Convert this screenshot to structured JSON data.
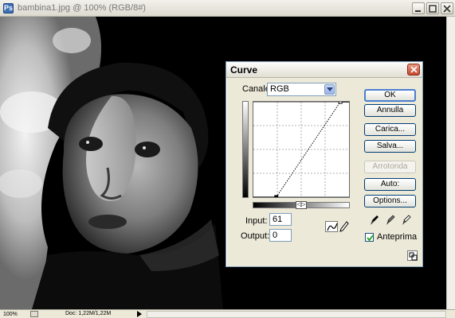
{
  "window": {
    "title": "bambina1.jpg @ 100% (RGB/8#)",
    "icon": "photoshop-document-icon",
    "controls": [
      "minimize-icon",
      "maximize-icon",
      "close-icon"
    ]
  },
  "status": {
    "zoom": "100%",
    "doc_info": "Doc: 1,22M/1,22M"
  },
  "dialog": {
    "title": "Curve",
    "channel_label": "Canale:",
    "channel_value": "RGB",
    "input_label": "Input:",
    "input_value": "61",
    "output_label": "Output:",
    "output_value": "0",
    "buttons": {
      "ok": "OK",
      "cancel": "Annulla",
      "load": "Carica...",
      "save": "Salva...",
      "smooth": "Arrotonda",
      "auto": "Auto:",
      "options": "Options..."
    },
    "preview_label": "Anteprima",
    "preview_checked": true,
    "gradient_toggle": "◁▷",
    "curve_points": [
      [
        61,
        0
      ],
      [
        232,
        255
      ]
    ],
    "colors": {
      "accent": "#4a7fd0",
      "close_red": "#c4462b",
      "dialog_bg": "#ece9d8"
    }
  }
}
